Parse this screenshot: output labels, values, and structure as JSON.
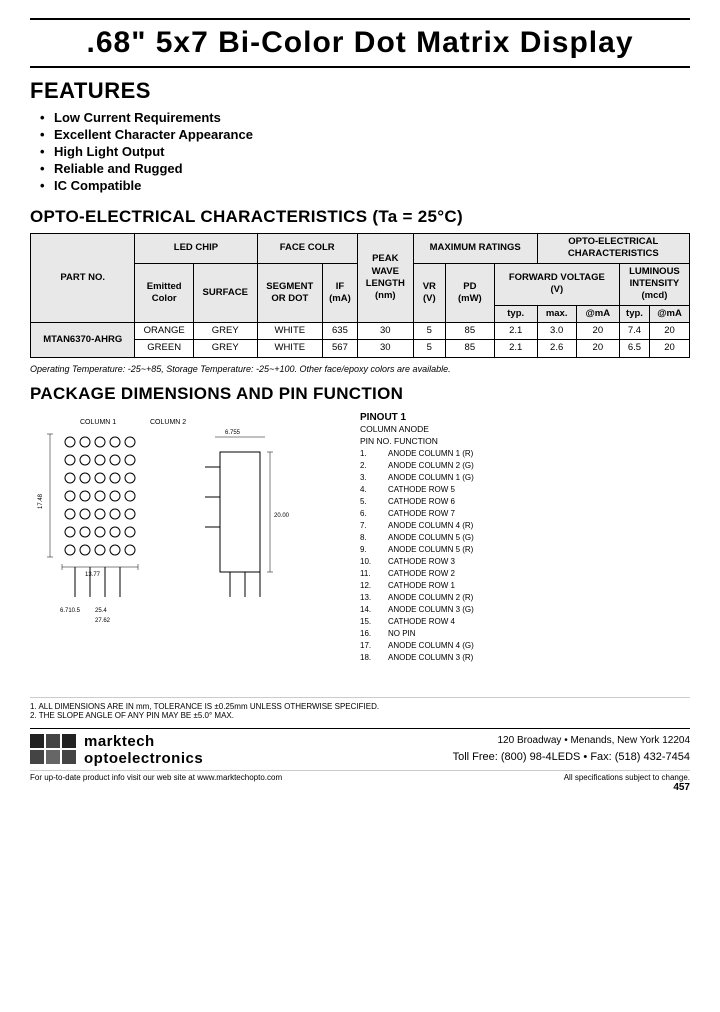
{
  "title": ".68\" 5x7 Bi-Color Dot Matrix Display",
  "features": {
    "section_title": "FEATURES",
    "items": [
      "Low Current Requirements",
      "Excellent Character Appearance",
      "High Light Output",
      "Reliable and Rugged",
      "IC Compatible"
    ]
  },
  "opto": {
    "section_title": "OPTO-ELECTRICAL CHARACTERISTICS (Ta = 25°C)",
    "table": {
      "headers": {
        "part_no": "PART NO.",
        "led_chip": "LED CHIP",
        "face_color": "FACE COLR",
        "peak_wave": "PEAK WAVE LENGTH (nm)",
        "max_ratings": "MAXIMUM RATINGS",
        "opto_chars": "OPTO-ELECTRICAL CHARACTERISTICS"
      },
      "sub_headers": {
        "emitted_color": "Emitted Color",
        "surface": "SURFACE",
        "segment_or_dot": "SEGMENT OR DOT",
        "if_ma": "IF (mA)",
        "vr_v": "VR (V)",
        "pd_mw": "PD (mW)",
        "fwd_voltage": "FORWARD VOLTAGE (V)",
        "luminous": "LUMINOUS INTENSITY (mcd)",
        "typ": "typ.",
        "max": "max.",
        "at_ma1": "@mA",
        "at_ma2": "@mA",
        "lum_typ": "typ.",
        "lum_at_ma": "@mA"
      },
      "rows": [
        {
          "part_no": "MTAN6370-AHRG",
          "emitted": "ORANGE",
          "surface": "GREY",
          "segment": "WHITE",
          "peak": "635",
          "if": "30",
          "vr": "5",
          "pd": "85",
          "fwd_typ": "2.1",
          "fwd_max": "3.0",
          "fwd_at_ma": "20",
          "lum_typ": "7.4",
          "lum_at_ma": "20"
        },
        {
          "part_no": "",
          "emitted": "GREEN",
          "surface": "GREY",
          "segment": "WHITE",
          "peak": "567",
          "if": "30",
          "vr": "5",
          "pd": "85",
          "fwd_typ": "2.1",
          "fwd_max": "2.6",
          "fwd_at_ma": "20",
          "lum_typ": "6.5",
          "lum_at_ma": "20"
        }
      ]
    },
    "note": "Operating Temperature: -25~+85, Storage Temperature: -25~+100. Other face/epoxy colors are available."
  },
  "package": {
    "section_title": "PACKAGE DIMENSIONS AND PIN FUNCTION",
    "pinout": {
      "title": "PINOUT 1",
      "subtitle1": "COLUMN ANODE",
      "subtitle2": "PIN NO.   FUNCTION",
      "pins": [
        {
          "num": "1.",
          "func": "ANODE COLUMN 1 (R)"
        },
        {
          "num": "2.",
          "func": "ANODE COLUMN 2 (G)"
        },
        {
          "num": "3.",
          "func": "ANODE COLUMN 1 (G)"
        },
        {
          "num": "4.",
          "func": "CATHODE ROW 5"
        },
        {
          "num": "5.",
          "func": "CATHODE ROW 6"
        },
        {
          "num": "6.",
          "func": "CATHODE ROW 7"
        },
        {
          "num": "7.",
          "func": "ANODE COLUMN 4 (R)"
        },
        {
          "num": "8.",
          "func": "ANODE COLUMN 5 (G)"
        },
        {
          "num": "9.",
          "func": "ANODE COLUMN 5 (R)"
        },
        {
          "num": "10.",
          "func": "CATHODE ROW 3"
        },
        {
          "num": "11.",
          "func": "CATHODE ROW 2"
        },
        {
          "num": "12.",
          "func": "CATHODE ROW 1"
        },
        {
          "num": "13.",
          "func": "ANODE COLUMN 2 (R)"
        },
        {
          "num": "14.",
          "func": "ANODE COLUMN 3 (G)"
        },
        {
          "num": "15.",
          "func": "CATHODE ROW 4"
        },
        {
          "num": "16.",
          "func": "NO PIN"
        },
        {
          "num": "17.",
          "func": "ANODE COLUMN 4 (G)"
        },
        {
          "num": "18.",
          "func": "ANODE COLUMN 3 (R)"
        }
      ]
    },
    "dim_notes": [
      "1. ALL DIMENSIONS ARE IN mm, TOLERANCE IS ±0.25mm UNLESS OTHERWISE SPECIFIED.",
      "2. THE SLOPE ANGLE OF ANY PIN MAY BE ±5.0° MAX."
    ]
  },
  "footer": {
    "logo_name1": "marktech",
    "logo_name2": "optoelectronics",
    "address": "120 Broadway • Menands, New York 12204",
    "tollfree": "Toll Free: (800) 98-4LEDS • Fax: (518) 432-7454",
    "website": "For up-to-date product info visit our web site at www.marktechopto.com",
    "specs_note": "All specifications subject to change.",
    "page_num": "457"
  }
}
